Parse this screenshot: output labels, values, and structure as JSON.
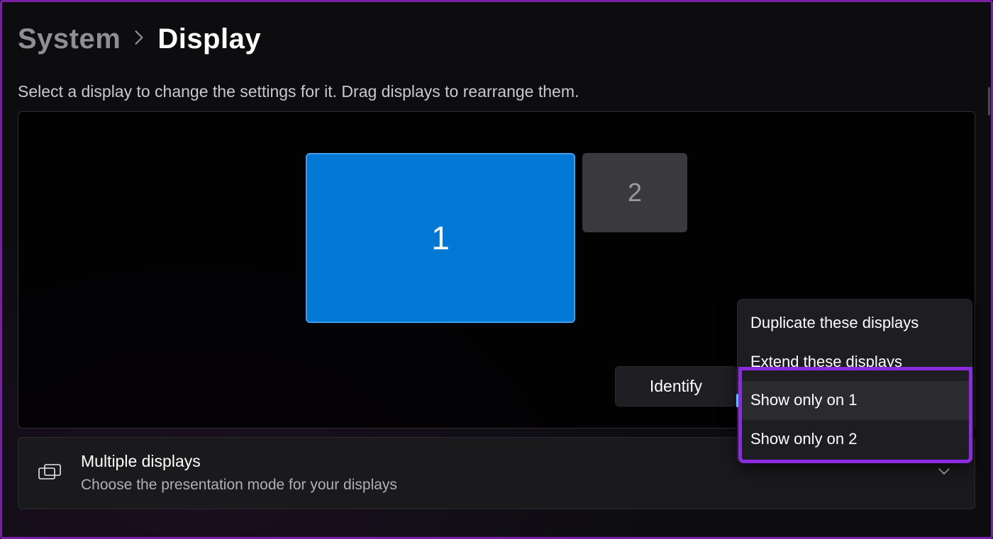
{
  "breadcrumb": {
    "parent": "System",
    "current": "Display"
  },
  "instruction": "Select a display to change the settings for it. Drag displays to rearrange them.",
  "displays": {
    "primary_label": "1",
    "secondary_label": "2"
  },
  "identify_button": "Identify",
  "dropdown": {
    "items": [
      "Duplicate these displays",
      "Extend these displays",
      "Show only on 1",
      "Show only on 2"
    ],
    "selected_index": 2
  },
  "setting_row": {
    "title": "Multiple displays",
    "subtitle": "Choose the presentation mode for your displays"
  },
  "colors": {
    "accent": "#0078d4",
    "highlight": "#8a2be2"
  }
}
